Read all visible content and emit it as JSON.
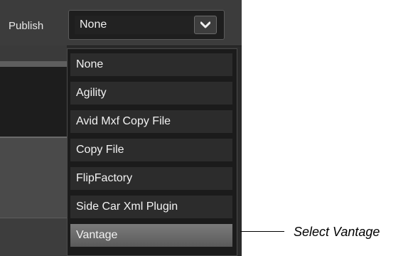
{
  "publish": {
    "label": "Publish",
    "selected_value": "None"
  },
  "dropdown": {
    "options": [
      {
        "label": "None"
      },
      {
        "label": "Agility"
      },
      {
        "label": "Avid Mxf Copy File"
      },
      {
        "label": "Copy File"
      },
      {
        "label": "FlipFactory"
      },
      {
        "label": "Side Car Xml Plugin"
      },
      {
        "label": "Vantage",
        "highlighted": true
      }
    ]
  },
  "callout": {
    "text": "Select Vantage"
  }
}
